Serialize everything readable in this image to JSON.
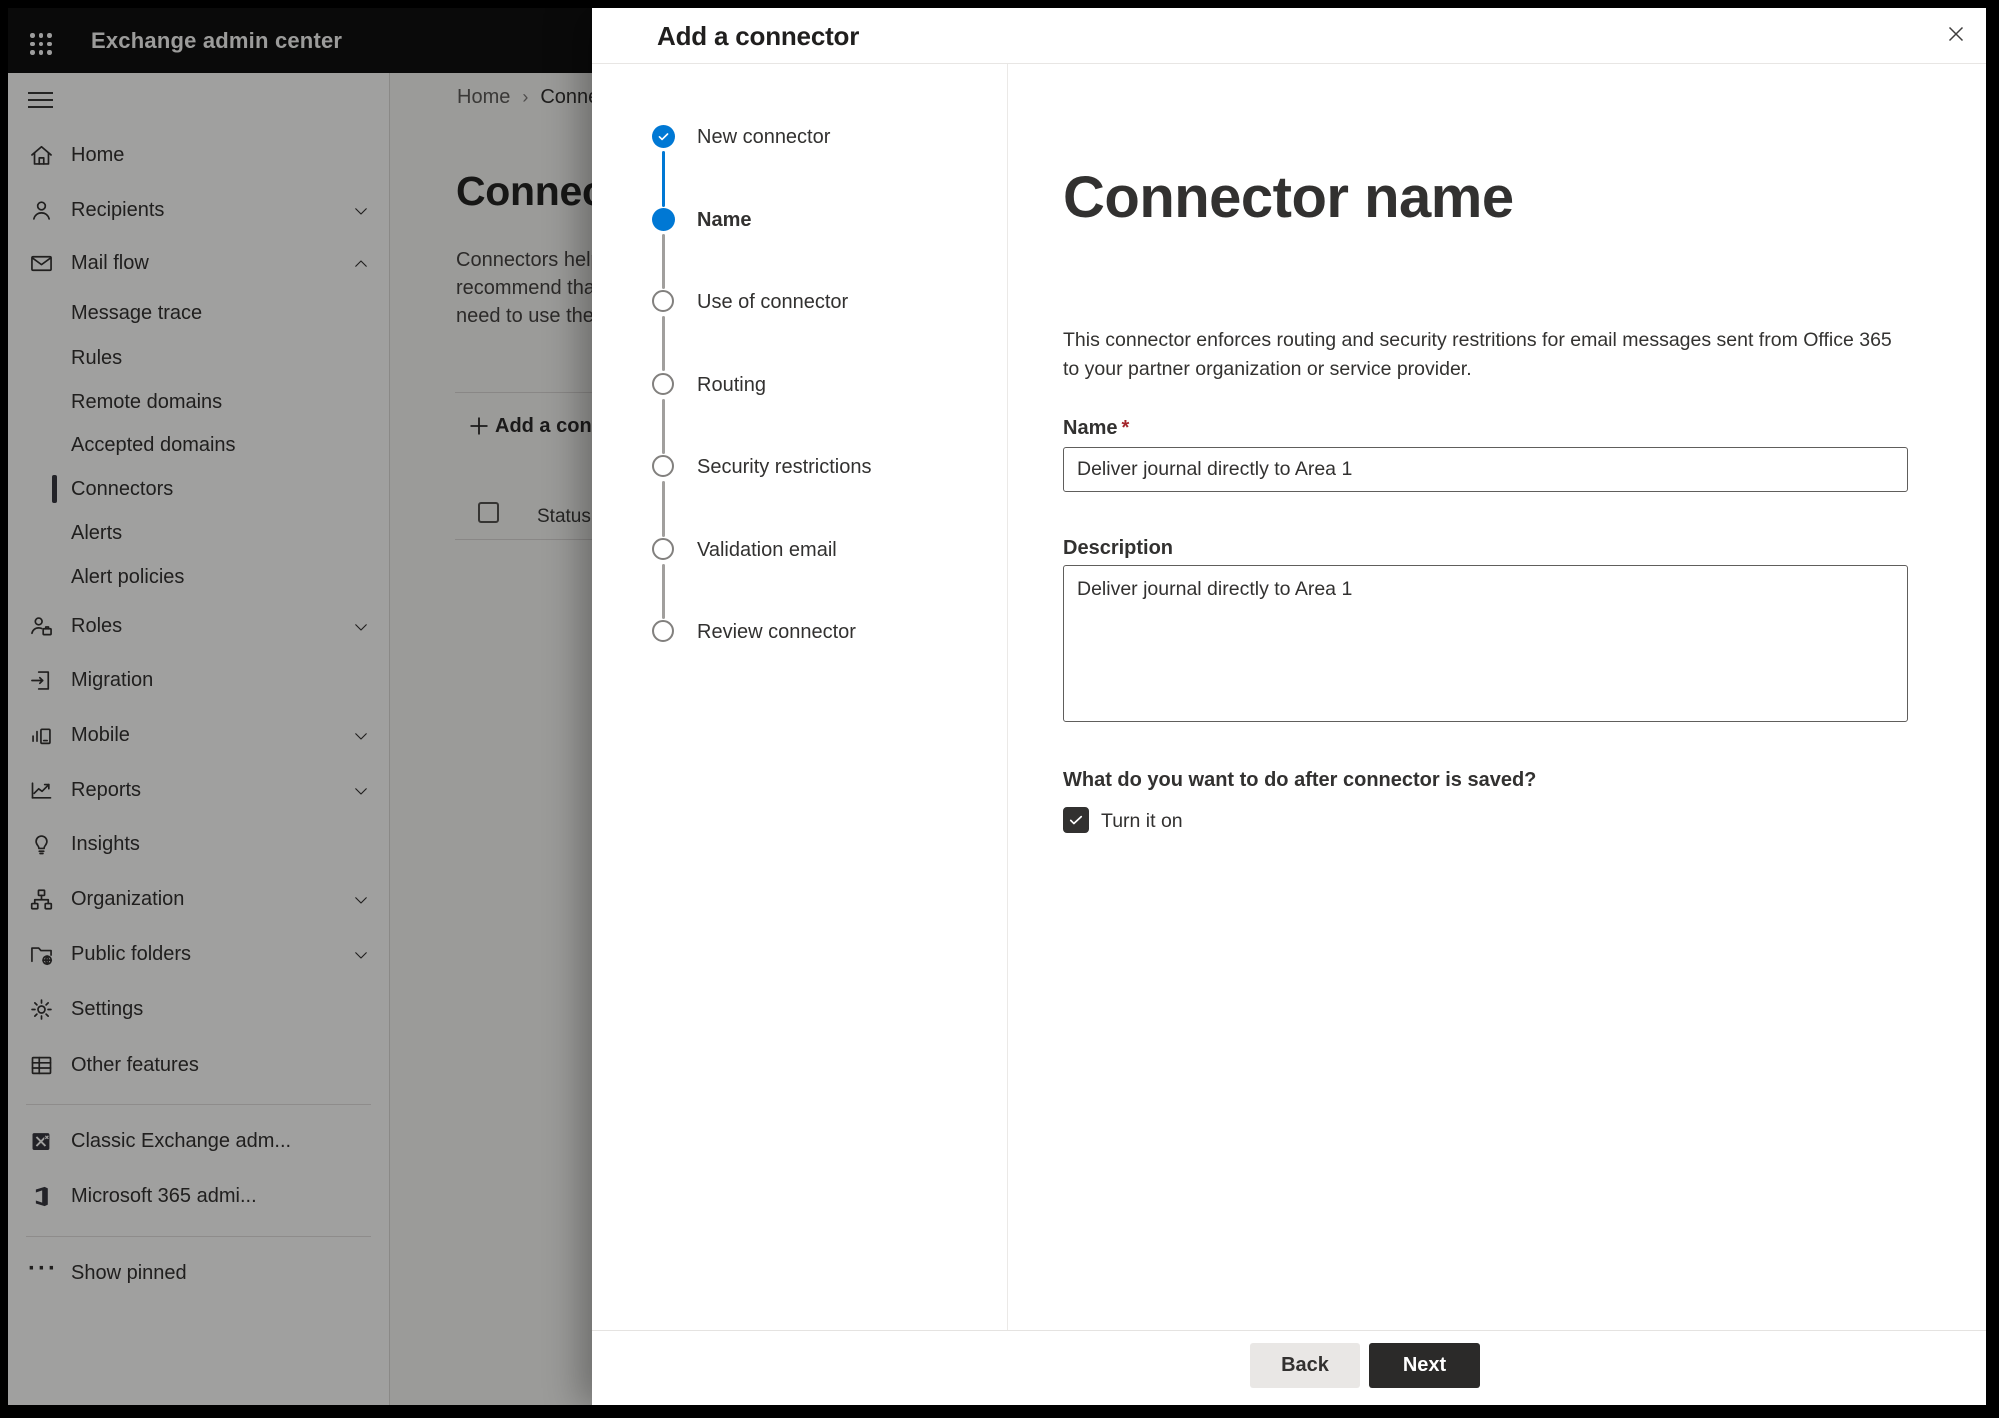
{
  "topbar": {
    "title": "Exchange admin center",
    "waffle_icon": "app-launcher-icon"
  },
  "sidebar": {
    "items": [
      {
        "label": "Home",
        "icon": "home-icon"
      },
      {
        "label": "Recipients",
        "icon": "person-icon",
        "chevron": "down"
      },
      {
        "label": "Mail flow",
        "icon": "mail-icon",
        "chevron": "up",
        "children": [
          "Message trace",
          "Rules",
          "Remote domains",
          "Accepted domains",
          "Connectors",
          "Alerts",
          "Alert policies"
        ],
        "selected_child": "Connectors"
      },
      {
        "label": "Roles",
        "icon": "roles-icon",
        "chevron": "down"
      },
      {
        "label": "Migration",
        "icon": "migration-icon"
      },
      {
        "label": "Mobile",
        "icon": "mobile-icon",
        "chevron": "down"
      },
      {
        "label": "Reports",
        "icon": "reports-icon",
        "chevron": "down"
      },
      {
        "label": "Insights",
        "icon": "lightbulb-icon"
      },
      {
        "label": "Organization",
        "icon": "org-chart-icon",
        "chevron": "down"
      },
      {
        "label": "Public folders",
        "icon": "folder-globe-icon",
        "chevron": "down"
      },
      {
        "label": "Settings",
        "icon": "gear-icon"
      },
      {
        "label": "Other features",
        "icon": "table-grid-icon"
      }
    ],
    "footer_items": [
      {
        "label": "Classic Exchange adm...",
        "icon": "exchange-logo-icon"
      },
      {
        "label": "Microsoft 365 admi...",
        "icon": "microsoft365-logo-icon"
      }
    ],
    "show_pinned": "Show pinned"
  },
  "background_page": {
    "breadcrumb": {
      "crumb1": "Home",
      "crumb2": "Conne"
    },
    "heading": "Connec",
    "paragraph_lines": [
      "Connectors help",
      "recommend that",
      "need to use ther"
    ],
    "add_button_label": "Add a conn",
    "table_header_status": "Status"
  },
  "dialog": {
    "title": "Add a connector",
    "close_icon": "close-icon",
    "steps": [
      {
        "label": "New connector",
        "state": "completed"
      },
      {
        "label": "Name",
        "state": "current"
      },
      {
        "label": "Use of connector",
        "state": "upcoming"
      },
      {
        "label": "Routing",
        "state": "upcoming"
      },
      {
        "label": "Security restrictions",
        "state": "upcoming"
      },
      {
        "label": "Validation email",
        "state": "upcoming"
      },
      {
        "label": "Review connector",
        "state": "upcoming"
      }
    ],
    "content": {
      "heading": "Connector name",
      "description_lines": [
        "This connector enforces routing and security restritions for email messages sent from Office 365",
        "to your partner organization or service provider."
      ],
      "name_label": "Name",
      "required_mark": "*",
      "name_value": "Deliver journal directly to Area 1",
      "description_label": "Description",
      "description_value": "Deliver journal directly to Area 1",
      "after_save_question": "What do you want to do after connector is saved?",
      "turn_on_label": "Turn it on",
      "turn_on_checked": true
    },
    "footer": {
      "back_label": "Back",
      "next_label": "Next"
    }
  },
  "colors": {
    "accent_blue": "#0078d4",
    "primary_button": "#2b2a29",
    "required_asterisk": "#a4262c",
    "checkbox_fill": "#323130",
    "step_pending_border": "#82807e"
  }
}
